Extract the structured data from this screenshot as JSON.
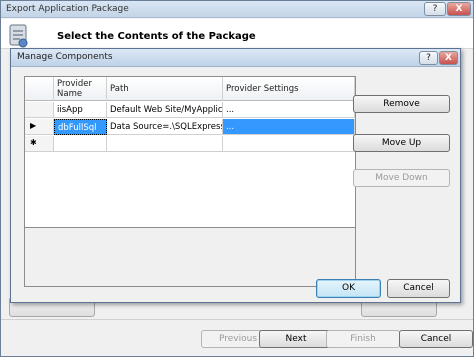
{
  "outer_window": {
    "title": "Export Application Package",
    "help_label": "?",
    "close_label": "X",
    "header_title": "Select the Contents of the Package",
    "buttons": {
      "previous": "Previous",
      "next": "Next",
      "finish": "Finish",
      "cancel": "Cancel"
    }
  },
  "dialog": {
    "title": "Manage Components",
    "help_label": "?",
    "close_label": "X",
    "grid": {
      "columns": [
        "Provider Name",
        "Path",
        "Provider Settings"
      ],
      "rows": [
        {
          "indicator": "",
          "provider_name": "iisApp",
          "path": "Default Web Site/MyApplic...",
          "settings": "..."
        },
        {
          "indicator": "▶",
          "provider_name": "dbFullSql",
          "path": "Data Source=.\\SQLExpress;Dat",
          "settings": "..."
        }
      ],
      "new_row_indicator": "✱"
    },
    "buttons": {
      "remove": "Remove",
      "move_up": "Move Up",
      "move_down": "Move Down",
      "ok": "OK",
      "cancel": "Cancel"
    }
  },
  "colors": {
    "selection": "#3399ff",
    "title_gradient_top": "#dce8f5",
    "close_button": "#c75050"
  }
}
